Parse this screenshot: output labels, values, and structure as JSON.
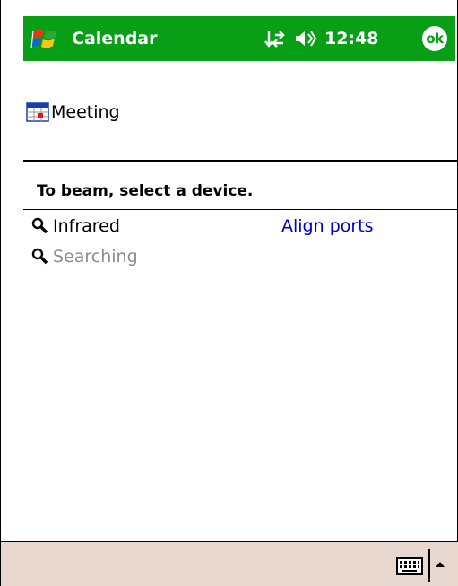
{
  "titlebar": {
    "app_title": "Calendar",
    "clock": "12:48",
    "ok_label": "ok",
    "color": "#089f17"
  },
  "icons": {
    "start": "windows-flag-icon",
    "connectivity": "connectivity-arrows-icon",
    "volume": "speaker-icon",
    "item": "calendar-icon",
    "search": "magnifier-icon",
    "keyboard": "keyboard-icon",
    "sip_menu": "up-arrow-icon"
  },
  "beam": {
    "item_label": "Meeting",
    "instruction": "To beam, select a device.",
    "devices": [
      {
        "name": "Infrared",
        "status": "Align ports",
        "state": "active"
      },
      {
        "name": "Searching",
        "status": "",
        "state": "searching"
      }
    ]
  },
  "colors": {
    "link": "#0000cc",
    "dimmed": "#8c8c8c",
    "menubar": "#e7d7cf"
  }
}
